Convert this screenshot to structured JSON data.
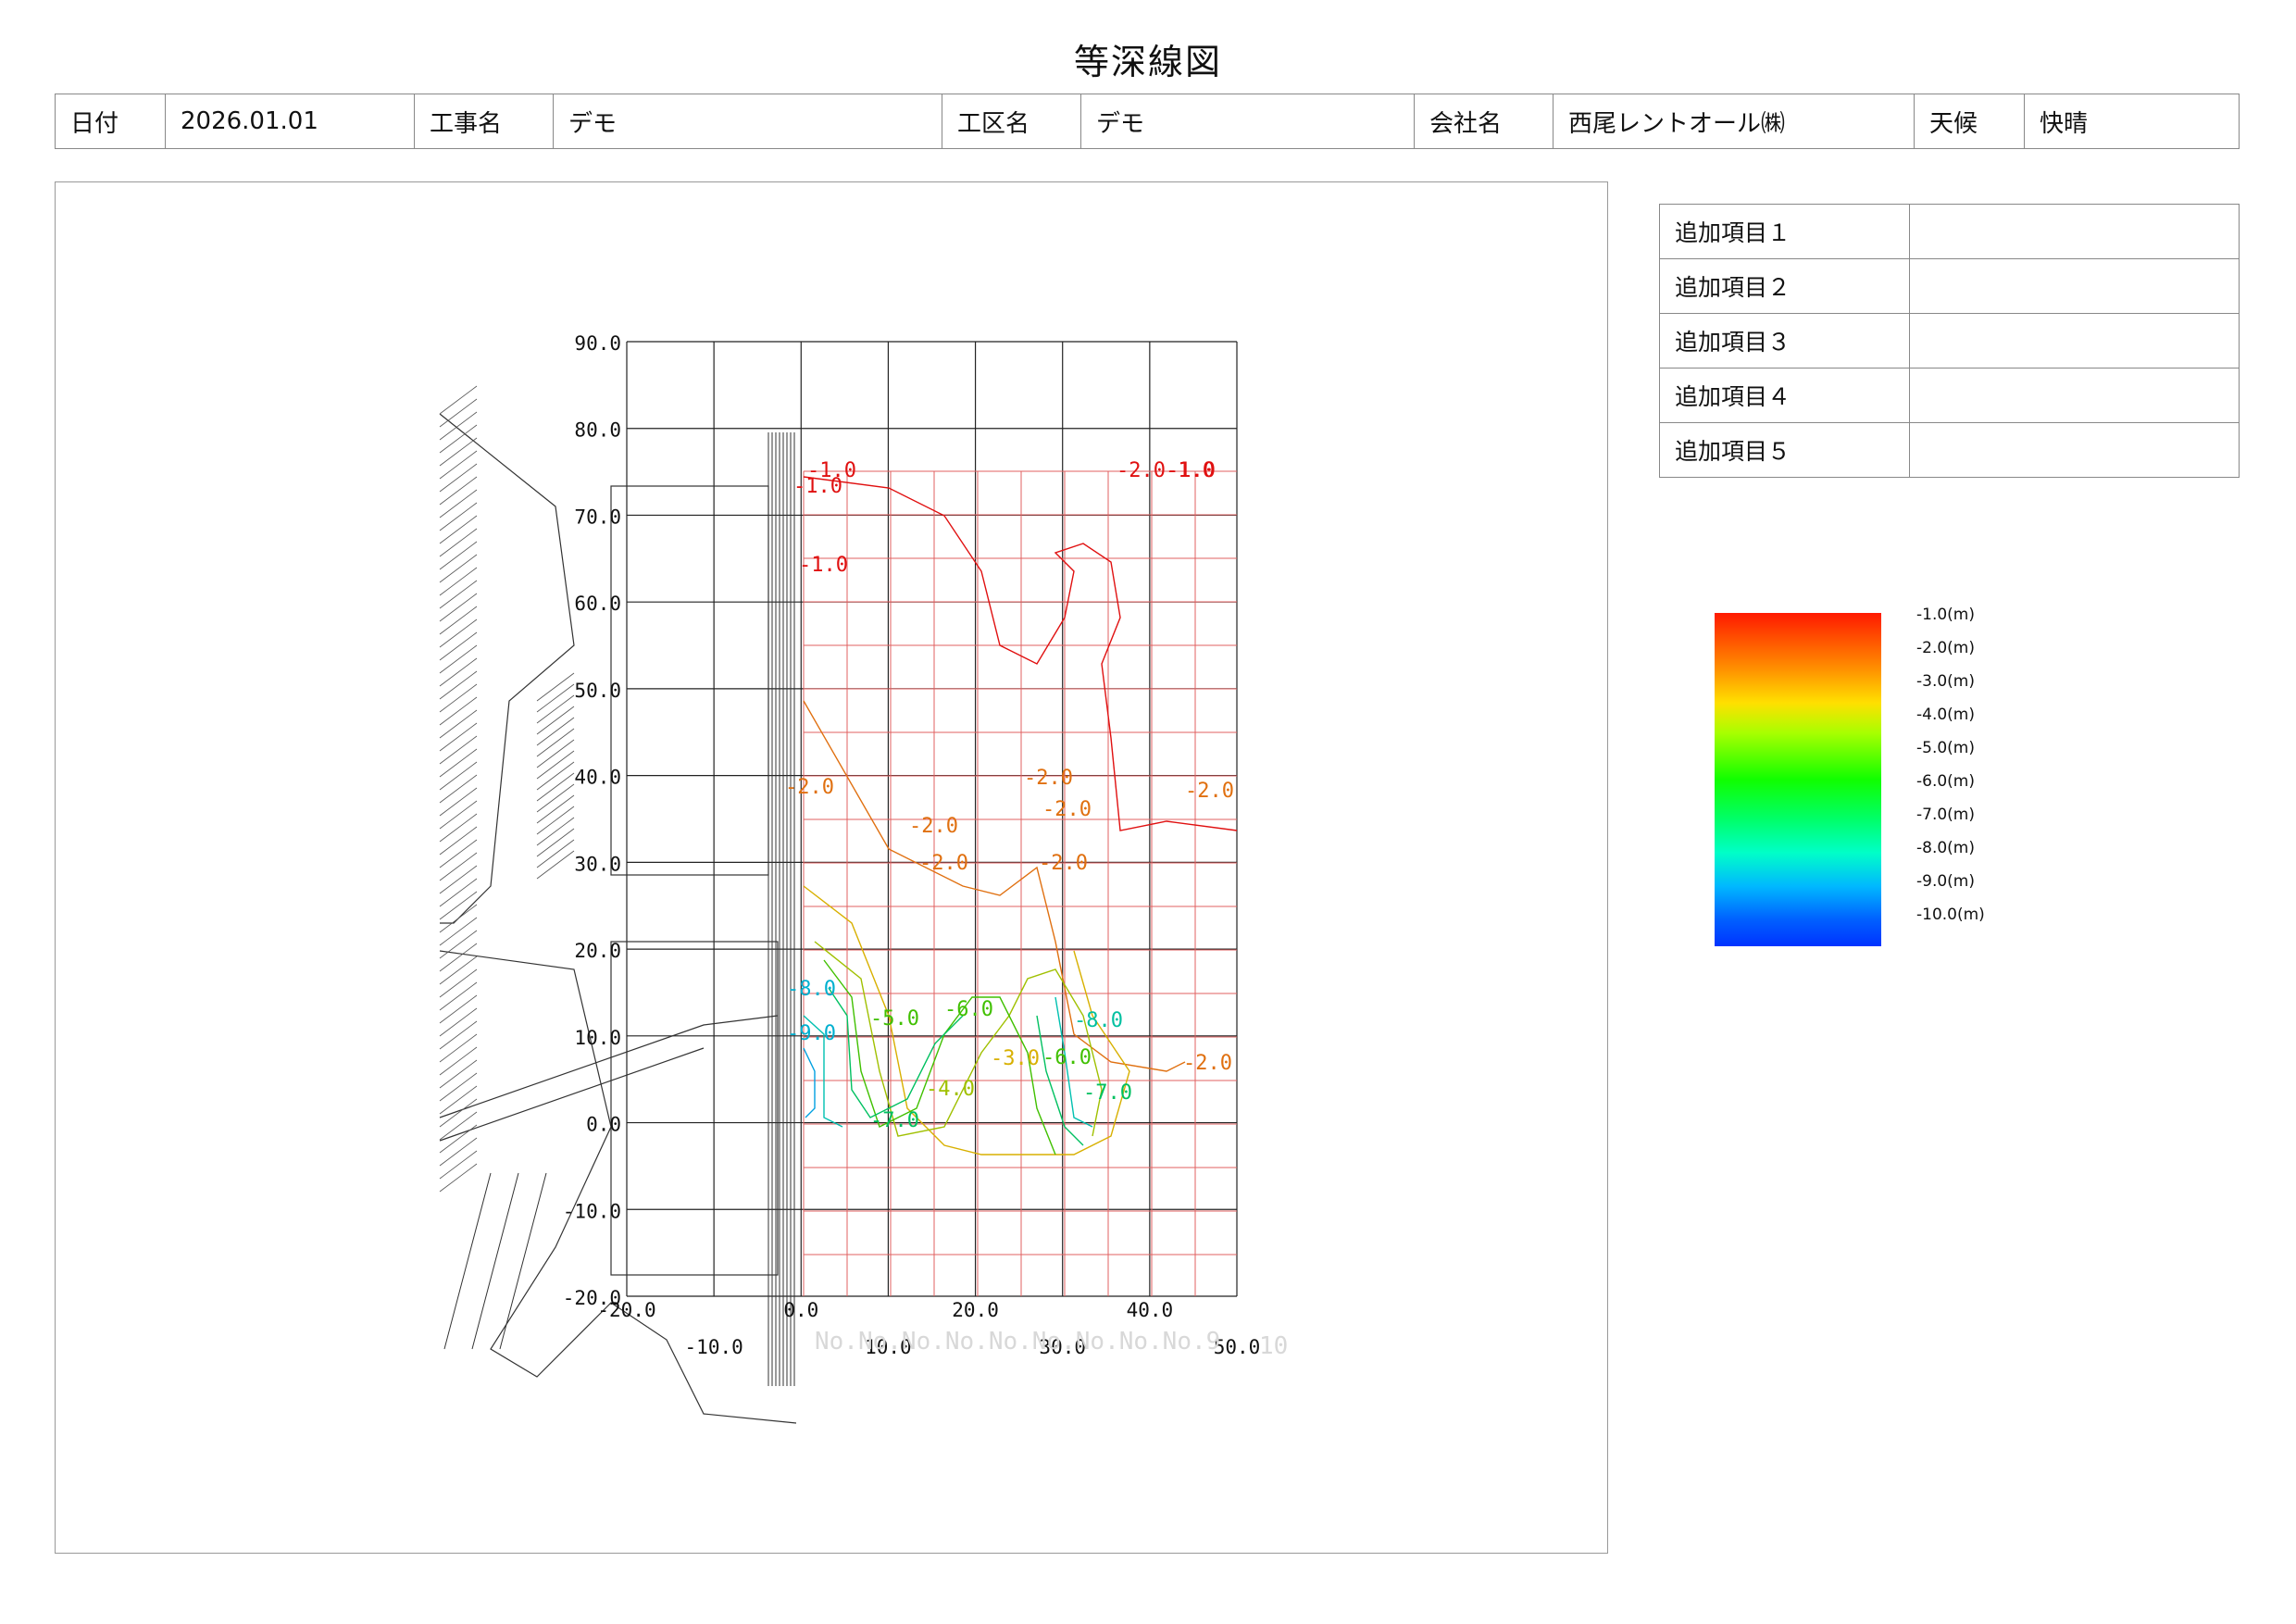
{
  "title": "等深線図",
  "header": {
    "date_label": "日付",
    "date_value": "2026.01.01",
    "project_label": "工事名",
    "project_value": "デモ",
    "section_label": "工区名",
    "section_value": "デモ",
    "company_label": "会社名",
    "company_value": "西尾レントオール㈱",
    "weather_label": "天候",
    "weather_value": "快晴"
  },
  "extra_items": [
    {
      "label": "追加項目１",
      "value": ""
    },
    {
      "label": "追加項目２",
      "value": ""
    },
    {
      "label": "追加項目３",
      "value": ""
    },
    {
      "label": "追加項目４",
      "value": ""
    },
    {
      "label": "追加項目５",
      "value": ""
    }
  ],
  "legend": {
    "labels": [
      "-1.0(m)",
      "-2.0(m)",
      "-3.0(m)",
      "-4.0(m)",
      "-5.0(m)",
      "-6.0(m)",
      "-7.0(m)",
      "-8.0(m)",
      "-9.0(m)",
      "-10.0(m)"
    ],
    "colors": [
      "#ff1a00",
      "#ff8a00",
      "#ffe000",
      "#a8ff00",
      "#10ff00",
      "#00ff6a",
      "#00ffc8",
      "#00b8ff",
      "#0060ff",
      "#0033ff"
    ]
  },
  "map": {
    "y_ticks": [
      "90.0",
      "80.0",
      "70.0",
      "60.0",
      "50.0",
      "40.0",
      "30.0",
      "20.0",
      "10.0",
      "0.0",
      "-10.0",
      "-20.0"
    ],
    "x_ticks_upper": [
      "-20.0",
      "0.0",
      "20.0",
      "40.0"
    ],
    "x_ticks_lower": [
      "-10.0",
      "10.0",
      "30.0",
      "50.0"
    ],
    "station_labels": "No.No.No.No.No.No.No.No.No.9",
    "station_end": "10",
    "contour_labels": [
      {
        "t": "-1.0",
        "c": "#e01010"
      },
      {
        "t": "-1.0",
        "c": "#e01010"
      },
      {
        "t": "-1.0",
        "c": "#e01010"
      },
      {
        "t": "-2.0-1.0",
        "c": "#e01010"
      },
      {
        "t": "-1.0",
        "c": "#e01010"
      },
      {
        "t": "-2.0",
        "c": "#e07010"
      },
      {
        "t": "-2.0",
        "c": "#e07010"
      },
      {
        "t": "-2.0",
        "c": "#e07010"
      },
      {
        "t": "-2.0",
        "c": "#e07010"
      },
      {
        "t": "-2.0",
        "c": "#e07010"
      },
      {
        "t": "-2.0",
        "c": "#e07010"
      },
      {
        "t": "-2.0",
        "c": "#e07010"
      },
      {
        "t": "-2.0",
        "c": "#e07010"
      },
      {
        "t": "-3.0",
        "c": "#d8b000"
      },
      {
        "t": "-4.0",
        "c": "#a0c000"
      },
      {
        "t": "-5.0",
        "c": "#40c000"
      },
      {
        "t": "-6.0",
        "c": "#40c000"
      },
      {
        "t": "-7.0",
        "c": "#00c060"
      },
      {
        "t": "-8.0",
        "c": "#00c0a0"
      },
      {
        "t": "-8.0",
        "c": "#00b0d0"
      },
      {
        "t": "-9.0",
        "c": "#00b0d0"
      },
      {
        "t": "-6.0",
        "c": "#40c000"
      },
      {
        "t": "-7.0",
        "c": "#00c060"
      }
    ]
  }
}
